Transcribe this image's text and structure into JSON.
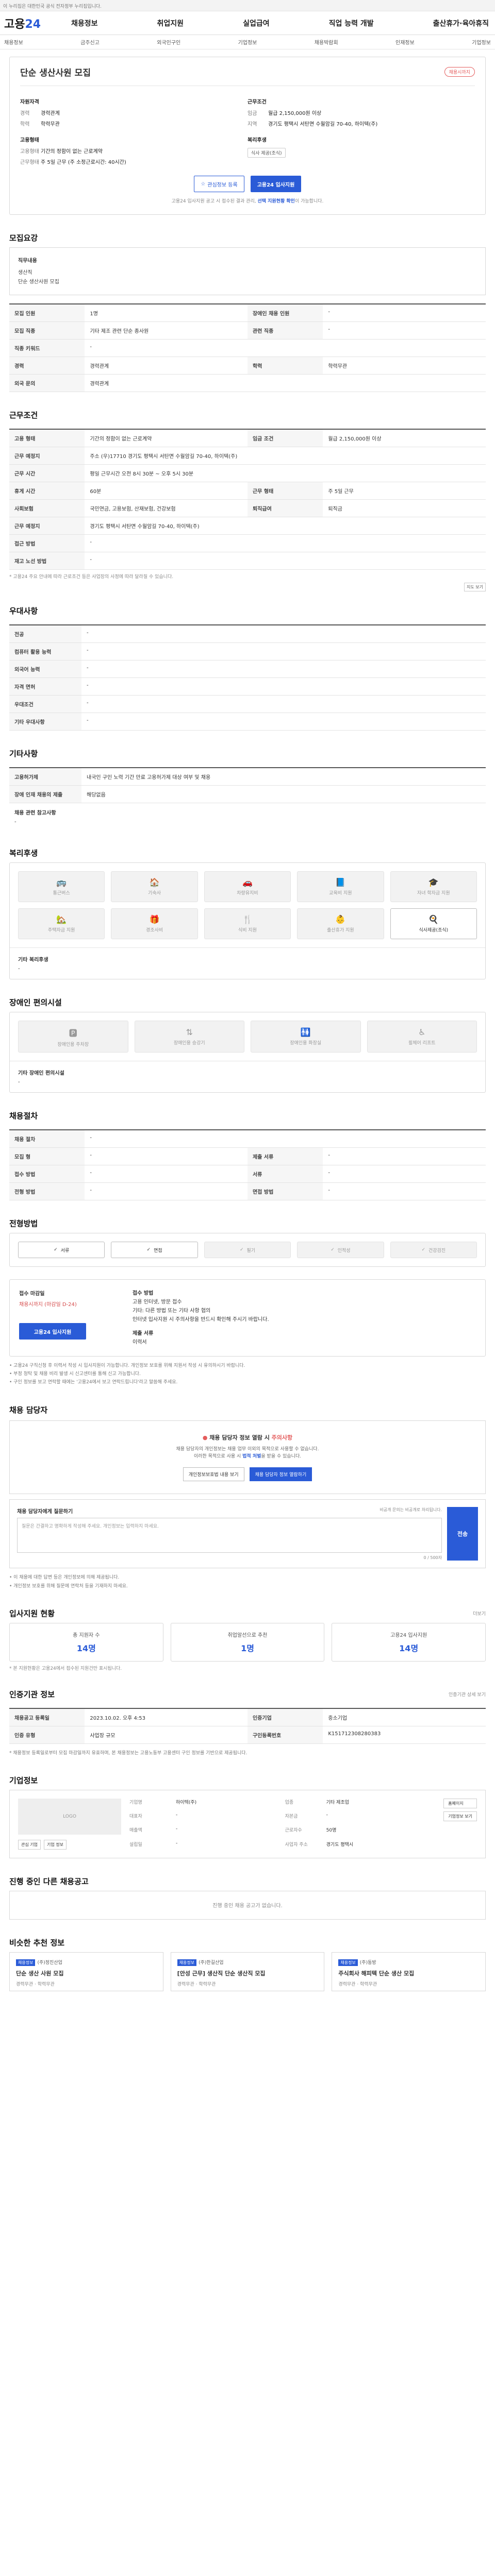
{
  "topbar": "이 누리집은 대한민국 공식 전자정부 누리집입니다.",
  "logo": {
    "a": "고용",
    "b": "24"
  },
  "gnb": [
    "채용정보",
    "취업지원",
    "실업급여",
    "직업 능력 개발",
    "출산휴가·육아휴직"
  ],
  "subnav": [
    "채용정보",
    "금주신고",
    "외국인구인",
    "기업정보",
    "채용박람회",
    "인재정보",
    "기업정보"
  ],
  "summary": {
    "title": "단순 생산사원 모집",
    "badge": "채용시까지",
    "left_title": "자원자격",
    "left": [
      {
        "k": "경력",
        "v": "경력관계"
      },
      {
        "k": "학력",
        "v": "학력무관"
      }
    ],
    "cond_title": "고용형태",
    "cond": [
      {
        "k": "고용형태",
        "v": "기간의 정함이 없는 근로계약"
      },
      {
        "k": "근무형태",
        "v": "주 5일 근무 (주 소정근로시간: 40시간)"
      }
    ],
    "right_title": "근무조건",
    "right": [
      {
        "k": "임금",
        "v": "월급 2,150,000원 이상"
      },
      {
        "k": "지역",
        "v": "경기도 평택시 서탄면 수월암길 70-40, 하이텍(주)"
      }
    ],
    "welfare_title": "복리후생",
    "welfare_tag": "식사 제공(조식)",
    "btn_fav": "관심정보 등록",
    "btn_apply": "고용24 입사지원",
    "note_a": "고용24 입사지원 공고 시 접수된 결과 관리, ",
    "note_b": "선택 지원현황 확인",
    "note_c": "이 가능합니다."
  },
  "job": {
    "title": "모집요강",
    "k1": "직무내용",
    "v1": "생산직",
    "v2": "단순 생산사원 모집",
    "rows": [
      [
        "모집 인원",
        "1명",
        "장애인 채용 인원",
        "-"
      ],
      [
        "모집 직종",
        "기타 제조 관련 단순 종사원",
        "관련 직종",
        "-"
      ],
      [
        "직종 키워드",
        "-",
        "",
        ""
      ],
      [
        "경력",
        "경력관계",
        "학력",
        "학력무관"
      ],
      [
        "외국 문의",
        "경력관계",
        "",
        ""
      ]
    ]
  },
  "work": {
    "title": "근무조건",
    "rows": [
      [
        "고용 형태",
        "기간의 정함이 없는 근로계약",
        "임금 조건",
        "월급 2,150,000원 이상"
      ],
      [
        "근무 예정지",
        "주소 (우)17710 경기도 평택시 서탄면 수월암길 70-40, 하이텍(주)",
        "",
        ""
      ],
      [
        "근무 시간",
        "평일 근무시간 오전 8시 30분 ~ 오후 5시 30분",
        "",
        ""
      ],
      [
        "휴게 시간",
        "60분",
        "근무 형태",
        "주 5일 근무"
      ],
      [
        "사회보험",
        "국민연금, 고용보험, 산재보험, 건강보험",
        "퇴직급여",
        "퇴직금"
      ],
      [
        "근무 예정지",
        "경기도 평택시 서탄면 수월암길 70-40, 하이텍(주)",
        "",
        ""
      ],
      [
        "접근 방법",
        "-",
        "",
        ""
      ],
      [
        "재고 노선 방법",
        "-",
        "",
        ""
      ]
    ],
    "fn": "* 고용24 주요 안내에 따라 근로조건 등은 사업장의 사정에 따라 달라질 수 있습니다.",
    "map_btn": "지도 보기"
  },
  "jobapp": {
    "title": "우대사항",
    "rows": [
      [
        "전공",
        "-"
      ],
      [
        "컴퓨터 활용 능력",
        "-"
      ],
      [
        "외국어 능력",
        "-"
      ],
      [
        "자격 면허",
        "-"
      ],
      [
        "우대조건",
        "-"
      ],
      [
        "기타 우대사항",
        "-"
      ]
    ]
  },
  "other": {
    "title": "기타사항",
    "rows": [
      [
        "고용허가제",
        "내국인 구인 노력 기간 만료 고용허가제 대상 여부 및 채용"
      ],
      [
        "장애 인재 채용의 제출",
        "해당없음"
      ]
    ],
    "more": "채용 관련 참고사항",
    "moreval": "-"
  },
  "benefits": {
    "title": "복리후생",
    "items": [
      "통근버스",
      "기숙사",
      "차량유지비",
      "교육비 지원",
      "자녀 학자금 지원",
      "주택자금 지원",
      "경조사비",
      "식비 지원",
      "출산휴가 지원",
      "식사제공(조식)"
    ],
    "foot_k": "기타 복리후생",
    "foot_v": "-"
  },
  "disabled": {
    "title": "장애인 편의시설",
    "items": [
      "장애인용 주차장",
      "장애인용 승강기",
      "장애인용 화장실",
      "휠체어 리프트"
    ],
    "foot_k": "기타 장애인 편의시설",
    "foot_v": "-"
  },
  "recruit": {
    "title": "채용절차",
    "rows": [
      [
        "채용 절차",
        "-",
        "",
        ""
      ],
      [
        "모집 형",
        "-",
        "제출 서류",
        "-"
      ],
      [
        "접수 방법",
        "-",
        "서류",
        "-"
      ],
      [
        "전형 방법",
        "-",
        "면접 방법",
        "-"
      ]
    ]
  },
  "selection": {
    "title": "전형방법",
    "items": [
      "서류",
      "면접",
      "필기",
      "인적성",
      "건강검진"
    ]
  },
  "apply": {
    "k": "접수 마감일",
    "v1": "채용시까지 (마감일 D-24)",
    "btn": "고용24 입사지원",
    "right_title": "접수 방법",
    "right": "고용 인터넷, 방문 접수\n기타: 다른 방법 또는 기타 사항 협의\n인터넷 입사지원 시 주의사항을 반드시 확인해 주시기 바랍니다.",
    "r2k": "제출 서류",
    "r2v": "이력서",
    "fine": "• 고용24 구직신청 후 이력서 작성 시 입사지원이 가능합니다. 개인정보 보호를 위해 지원서 작성 시 유의하시기 바랍니다.\n• 부정 청탁 및 채용 비리 발생 시 신고센터를 통해 신고 가능합니다.\n• 구인 정보를 보고 연락할 때에는 '고용24에서 보고 연락드립니다'라고 말씀해 주세요."
  },
  "contact": {
    "title": "채용 담당자",
    "a1_pre": "채용 담당자 정보 열람 시 ",
    "a1_red": "주의사항",
    "a2": "채용 담당자의 개인정보는 채용 업무 이외의 목적으로 사용할 수 없습니다.",
    "a3_pre": "이러한 목적으로 사용 시 ",
    "a3_b": "법적 처벌",
    "a3_post": "을 받을 수 있습니다.",
    "b1": "개인정보보호법 내용 보기",
    "b2": "채용 담당자 정보 열람하기"
  },
  "question": {
    "title": "채용 담당자에게 질문하기",
    "note": "비공개 문의는 비공개로 처리됩니다.",
    "ph": "질문은 간결하고 명확하게 작성해 주세요. 개인정보는 입력하지 마세요.",
    "count": "0 / 500자",
    "btn": "전송",
    "fine": "• 이 채용에 대한 답변 등은 개인정보에 의해 제공됩니다.\n• 개인정보 보호를 위해 질문에 연락처 등을 기재하지 마세요."
  },
  "stats": {
    "title": "입사지원 현황",
    "more": "더보기",
    "items": [
      {
        "k": "총 지원자 수",
        "v": "14명"
      },
      {
        "k": "취업알선으로 추천",
        "v": "1명"
      },
      {
        "k": "고용24 입사지원",
        "v": "14명"
      }
    ],
    "fn": "* 본 지원현황은 고용24에서 접수된 지원건만 표시됩니다."
  },
  "info": {
    "title": "인증기관 정보",
    "btn": "인증기관 상세 보기",
    "rows": [
      [
        "채용공고 등록일",
        "2023.10.02. 오후 4:53",
        "인증기업",
        "중소기업"
      ],
      [
        "인증 유형",
        "사업장 규모",
        "구인등록번호",
        "K151712308280383"
      ]
    ],
    "fine": "* 채용정보 등록일로부터 모집 마감일까지 유효하며, 본 채용정보는 고용노동부 고용센터 구인 정보를 기반으로 제공됩니다."
  },
  "company": {
    "title": "기업정보",
    "logo": "LOGO",
    "links": [
      "관심 기업",
      "기업 정보"
    ],
    "rows": [
      [
        "기업명",
        "하이텍(주)",
        "업종",
        "기타 제조업"
      ],
      [
        "대표자",
        "-",
        "자본금",
        "-"
      ],
      [
        "매출액",
        "-",
        "근로자수",
        "50명"
      ],
      [
        "설립일",
        "-",
        "사업자 주소",
        "경기도 평택시"
      ]
    ],
    "side": [
      "홈페이지",
      "기업정보 보기"
    ]
  },
  "progress": {
    "title": "진행 중인 다른 채용공고",
    "empty": "진행 중인 채용 공고가 없습니다."
  },
  "rec": {
    "title": "비슷한 추천 정보",
    "items": [
      {
        "b": "채용정보",
        "c": "(주)정진산업",
        "t": "단순 생산 사원 모집",
        "m": "경력무관 · 학력무관"
      },
      {
        "b": "채용정보",
        "c": "(주)한길산업",
        "t": "[안성 근무] 생산직 단순 생산직 모집",
        "m": "경력무관 · 학력무관"
      },
      {
        "b": "채용정보",
        "c": "(주)동방",
        "t": "주식회사 해피텍 단순 생산 모집",
        "m": "경력무관 · 학력무관"
      }
    ]
  }
}
